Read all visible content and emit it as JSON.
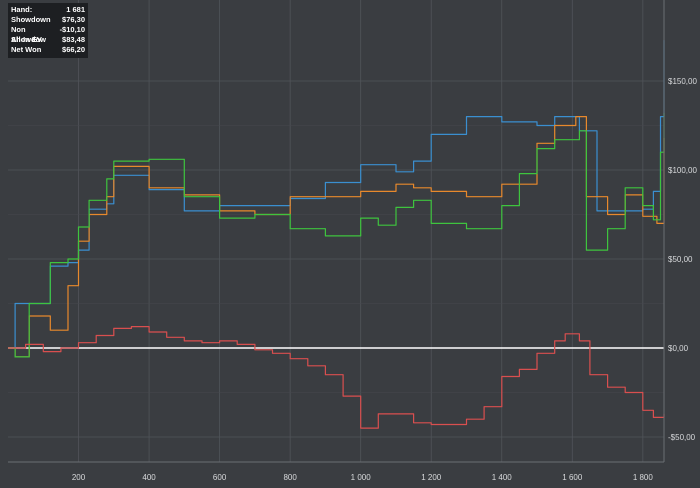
{
  "stats": [
    {
      "label": "Hand:",
      "value": "1 681"
    },
    {
      "label": "Showdown",
      "value": "$76,30"
    },
    {
      "label": "Non Showdow",
      "value": "-$10,10"
    },
    {
      "label": "All-In EV",
      "value": "$83,48"
    },
    {
      "label": "Net Won",
      "value": "$66,20"
    }
  ],
  "chart_data": {
    "type": "line",
    "title": "",
    "xlabel": "",
    "ylabel": "",
    "xlim": [
      0,
      1860
    ],
    "ylim": [
      -60,
      170
    ],
    "x_ticks": [
      200,
      400,
      600,
      800,
      1000,
      1200,
      1400,
      1600,
      1800
    ],
    "x_tick_labels": [
      "200",
      "400",
      "600",
      "800",
      "1 000",
      "1 200",
      "1 400",
      "1 600",
      "1 800"
    ],
    "y_ticks": [
      150,
      100,
      50,
      0,
      -50
    ],
    "y_tick_labels": [
      "$150,00",
      "$100,00",
      "$50,00",
      "$0,00",
      "-$50,00"
    ],
    "grid": true,
    "series": [
      {
        "color": "#3a8fd0",
        "points": [
          [
            0,
            0
          ],
          [
            20,
            25
          ],
          [
            60,
            25
          ],
          [
            120,
            46
          ],
          [
            170,
            48
          ],
          [
            200,
            55
          ],
          [
            230,
            78
          ],
          [
            280,
            81
          ],
          [
            300,
            97
          ],
          [
            400,
            89
          ],
          [
            500,
            77
          ],
          [
            600,
            80
          ],
          [
            700,
            80
          ],
          [
            800,
            84
          ],
          [
            900,
            93
          ],
          [
            1000,
            103
          ],
          [
            1100,
            99
          ],
          [
            1150,
            105
          ],
          [
            1200,
            120
          ],
          [
            1300,
            130
          ],
          [
            1400,
            127
          ],
          [
            1500,
            125
          ],
          [
            1550,
            130
          ],
          [
            1620,
            122
          ],
          [
            1670,
            77
          ],
          [
            1750,
            77
          ],
          [
            1800,
            78
          ],
          [
            1830,
            88
          ],
          [
            1850,
            130
          ],
          [
            1860,
            173
          ]
        ]
      },
      {
        "color": "#e8892c",
        "points": [
          [
            0,
            0
          ],
          [
            20,
            -5
          ],
          [
            60,
            18
          ],
          [
            120,
            10
          ],
          [
            170,
            35
          ],
          [
            200,
            60
          ],
          [
            230,
            75
          ],
          [
            280,
            85
          ],
          [
            300,
            102
          ],
          [
            400,
            90
          ],
          [
            500,
            86
          ],
          [
            600,
            77
          ],
          [
            700,
            75
          ],
          [
            800,
            85
          ],
          [
            900,
            85
          ],
          [
            1000,
            88
          ],
          [
            1100,
            92
          ],
          [
            1150,
            90
          ],
          [
            1200,
            88
          ],
          [
            1300,
            85
          ],
          [
            1400,
            92
          ],
          [
            1500,
            115
          ],
          [
            1550,
            125
          ],
          [
            1610,
            130
          ],
          [
            1640,
            85
          ],
          [
            1700,
            75
          ],
          [
            1750,
            86
          ],
          [
            1800,
            74
          ],
          [
            1840,
            70
          ],
          [
            1860,
            118
          ]
        ]
      },
      {
        "color": "#3ec43e",
        "points": [
          [
            0,
            0
          ],
          [
            20,
            -5
          ],
          [
            60,
            25
          ],
          [
            120,
            48
          ],
          [
            170,
            50
          ],
          [
            200,
            68
          ],
          [
            230,
            83
          ],
          [
            280,
            95
          ],
          [
            300,
            105
          ],
          [
            400,
            106
          ],
          [
            500,
            85
          ],
          [
            600,
            73
          ],
          [
            700,
            75
          ],
          [
            800,
            67
          ],
          [
            900,
            63
          ],
          [
            1000,
            73
          ],
          [
            1050,
            69
          ],
          [
            1100,
            79
          ],
          [
            1150,
            83
          ],
          [
            1200,
            70
          ],
          [
            1300,
            67
          ],
          [
            1400,
            80
          ],
          [
            1450,
            98
          ],
          [
            1500,
            112
          ],
          [
            1550,
            117
          ],
          [
            1620,
            122
          ],
          [
            1640,
            55
          ],
          [
            1700,
            67
          ],
          [
            1750,
            90
          ],
          [
            1800,
            80
          ],
          [
            1830,
            72
          ],
          [
            1850,
            110
          ],
          [
            1860,
            132
          ]
        ]
      },
      {
        "color": "#d94f4f",
        "points": [
          [
            0,
            0
          ],
          [
            50,
            2
          ],
          [
            100,
            -2
          ],
          [
            150,
            0
          ],
          [
            200,
            3
          ],
          [
            250,
            7
          ],
          [
            300,
            11
          ],
          [
            350,
            12
          ],
          [
            400,
            9
          ],
          [
            450,
            6
          ],
          [
            500,
            4
          ],
          [
            550,
            3
          ],
          [
            600,
            4
          ],
          [
            650,
            2
          ],
          [
            700,
            -1
          ],
          [
            750,
            -3
          ],
          [
            800,
            -6
          ],
          [
            850,
            -10
          ],
          [
            900,
            -15
          ],
          [
            950,
            -27
          ],
          [
            1000,
            -45
          ],
          [
            1050,
            -37
          ],
          [
            1100,
            -37
          ],
          [
            1150,
            -42
          ],
          [
            1200,
            -43
          ],
          [
            1250,
            -43
          ],
          [
            1300,
            -40
          ],
          [
            1350,
            -33
          ],
          [
            1400,
            -16
          ],
          [
            1450,
            -12
          ],
          [
            1500,
            -3
          ],
          [
            1550,
            4
          ],
          [
            1580,
            8
          ],
          [
            1620,
            4
          ],
          [
            1650,
            -15
          ],
          [
            1700,
            -22
          ],
          [
            1750,
            -25
          ],
          [
            1800,
            -35
          ],
          [
            1830,
            -39
          ],
          [
            1860,
            -37
          ]
        ]
      }
    ]
  }
}
